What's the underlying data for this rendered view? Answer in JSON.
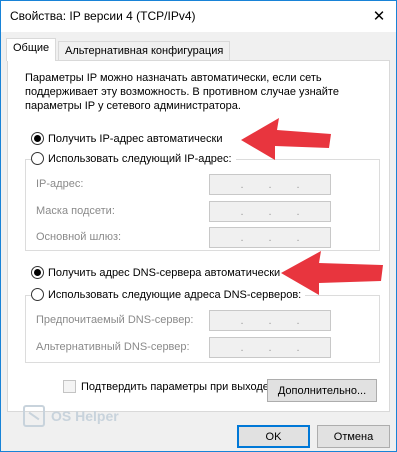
{
  "window": {
    "title": "Свойства: IP версии 4 (TCP/IPv4)",
    "close_glyph": "✕"
  },
  "tabs": [
    {
      "label": "Общие",
      "active": true
    },
    {
      "label": "Альтернативная конфигурация",
      "active": false
    }
  ],
  "description": "Параметры IP можно назначать автоматически, если сеть поддерживает эту возможность. В противном случае узнайте параметры IP у сетевого администратора.",
  "ip_section": {
    "auto_label": "Получить IP-адрес автоматически",
    "auto_checked": true,
    "manual_label": "Использовать следующий IP-адрес:",
    "manual_checked": false,
    "fields": [
      {
        "label": "IP-адрес:"
      },
      {
        "label": "Маска подсети:"
      },
      {
        "label": "Основной шлюз:"
      }
    ]
  },
  "dns_section": {
    "auto_label": "Получить адрес DNS-сервера автоматически",
    "auto_checked": true,
    "manual_label": "Использовать следующие адреса DNS-серверов:",
    "manual_checked": false,
    "fields": [
      {
        "label": "Предпочитаемый DNS-сервер:"
      },
      {
        "label": "Альтернативный DNS-сервер:"
      }
    ]
  },
  "validate_checkbox": {
    "label": "Подтвердить параметры при выходе",
    "checked": false
  },
  "buttons": {
    "advanced": "Дополнительно...",
    "ok": "OK",
    "cancel": "Отмена"
  },
  "watermark": {
    "text": "OS Helper"
  },
  "colors": {
    "accent": "#0078d7",
    "arrow": "#e8353e",
    "disabled_text": "#8a8a8a"
  },
  "icons": {
    "close": "close-icon",
    "arrow": "red-arrow-icon"
  }
}
